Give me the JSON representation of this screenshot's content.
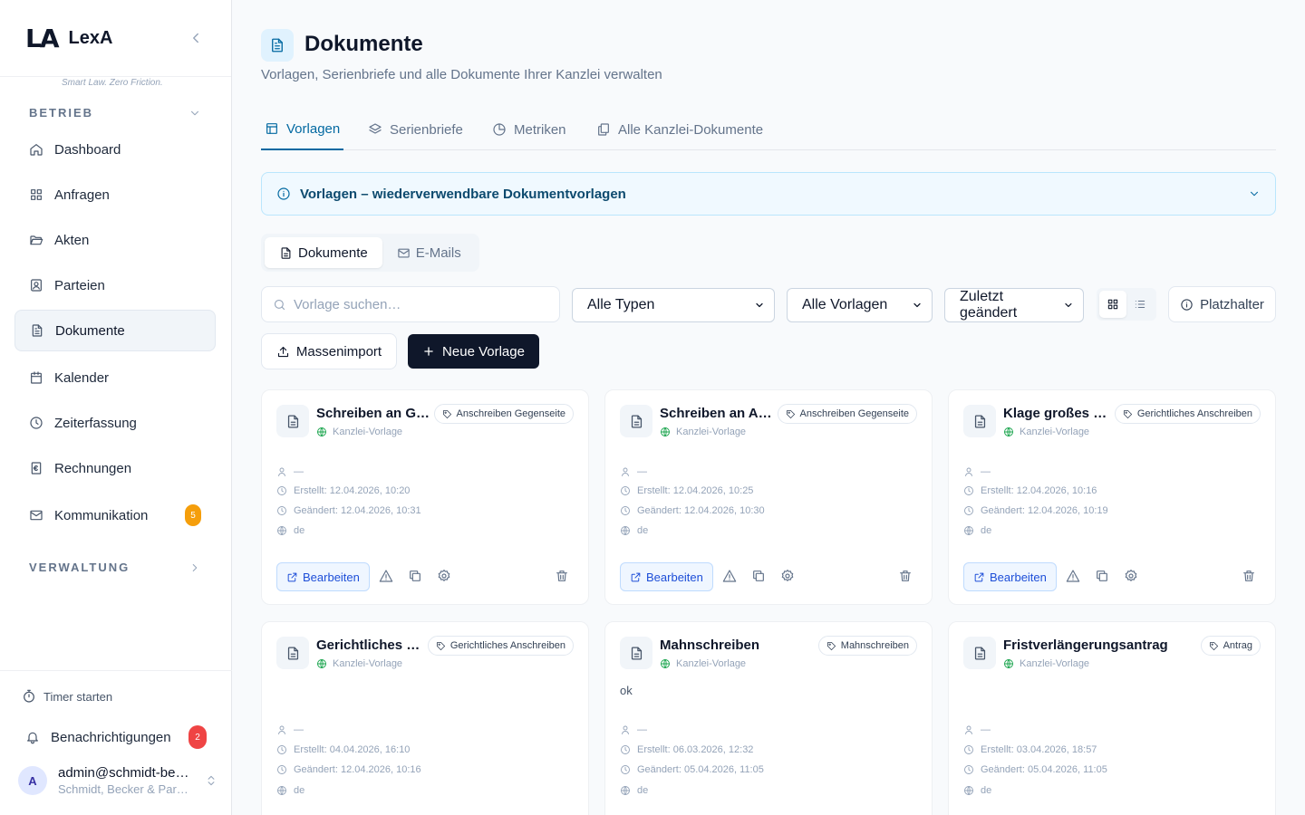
{
  "brand": {
    "logo": "LA",
    "name": "LexA",
    "tagline": "Smart Law. Zero Friction."
  },
  "sidebar": {
    "section_betrieb": "BETRIEB",
    "section_verwaltung": "VERWALTUNG",
    "items": [
      {
        "label": "Dashboard",
        "icon": "home-icon"
      },
      {
        "label": "Anfragen",
        "icon": "grid-icon"
      },
      {
        "label": "Akten",
        "icon": "folder-open-icon"
      },
      {
        "label": "Parteien",
        "icon": "contact-icon"
      },
      {
        "label": "Dokumente",
        "icon": "file-text-icon"
      },
      {
        "label": "Kalender",
        "icon": "calendar-icon"
      },
      {
        "label": "Zeiterfassung",
        "icon": "clock-icon"
      },
      {
        "label": "Rechnungen",
        "icon": "invoice-icon"
      },
      {
        "label": "Kommunikation",
        "icon": "mail-icon",
        "badge": "5"
      }
    ],
    "timer": "Timer starten",
    "notifications": {
      "label": "Benachrichtigungen",
      "badge": "2"
    },
    "user": {
      "initial": "A",
      "email": "admin@schmidt-becker.de",
      "org": "Schmidt, Becker & Partner"
    }
  },
  "page": {
    "title": "Dokumente",
    "subtitle": "Vorlagen, Serienbriefe und alle Dokumente Ihrer Kanzlei verwalten"
  },
  "tabs": [
    {
      "label": "Vorlagen",
      "active": true
    },
    {
      "label": "Serienbriefe"
    },
    {
      "label": "Metriken"
    },
    {
      "label": "Alle Kanzlei-Dokumente"
    }
  ],
  "info": {
    "text": "Vorlagen – wiederverwendbare Dokumentvorlagen"
  },
  "segments": [
    {
      "label": "Dokumente",
      "active": true
    },
    {
      "label": "E-Mails"
    }
  ],
  "filters": {
    "search_placeholder": "Vorlage suchen…",
    "type": "Alle Typen",
    "scope": "Alle Vorlagen",
    "sort": "Zuletzt geändert",
    "placeholder_btn": "Platzhalter"
  },
  "actions": {
    "import": "Massenimport",
    "new": "Neue Vorlage"
  },
  "card_labels": {
    "edit": "Bearbeiten",
    "scope": "Kanzlei-Vorlage",
    "author": "—",
    "language": "de"
  },
  "cards": [
    {
      "title": "Schreiben an G…",
      "tag": "Anschreiben Gegenseite",
      "desc": "",
      "created": "Erstellt: 12.04.2026, 10:20",
      "changed": "Geändert: 12.04.2026, 10:31"
    },
    {
      "title": "Schreiben an A…",
      "tag": "Anschreiben Gegenseite",
      "desc": "",
      "created": "Erstellt: 12.04.2026, 10:25",
      "changed": "Geändert: 12.04.2026, 10:30"
    },
    {
      "title": "Klage großes …",
      "tag": "Gerichtliches Anschreiben",
      "desc": "",
      "created": "Erstellt: 12.04.2026, 10:16",
      "changed": "Geändert: 12.04.2026, 10:19"
    },
    {
      "title": "Gerichtliches …",
      "tag": "Gerichtliches Anschreiben",
      "desc": "",
      "created": "Erstellt: 04.04.2026, 16:10",
      "changed": "Geändert: 12.04.2026, 10:16"
    },
    {
      "title": "Mahnschreiben",
      "tag": "Mahnschreiben",
      "desc": "ok",
      "created": "Erstellt: 06.03.2026, 12:32",
      "changed": "Geändert: 05.04.2026, 11:05"
    },
    {
      "title": "Fristverlängerungsantrag",
      "tag": "Antrag",
      "desc": "",
      "created": "Erstellt: 03.04.2026, 18:57",
      "changed": "Geändert: 05.04.2026, 11:05"
    }
  ],
  "colors": {
    "accent": "#0369a1",
    "primary": "#0f172a",
    "warning": "#f59e0b",
    "danger": "#ef4444"
  }
}
